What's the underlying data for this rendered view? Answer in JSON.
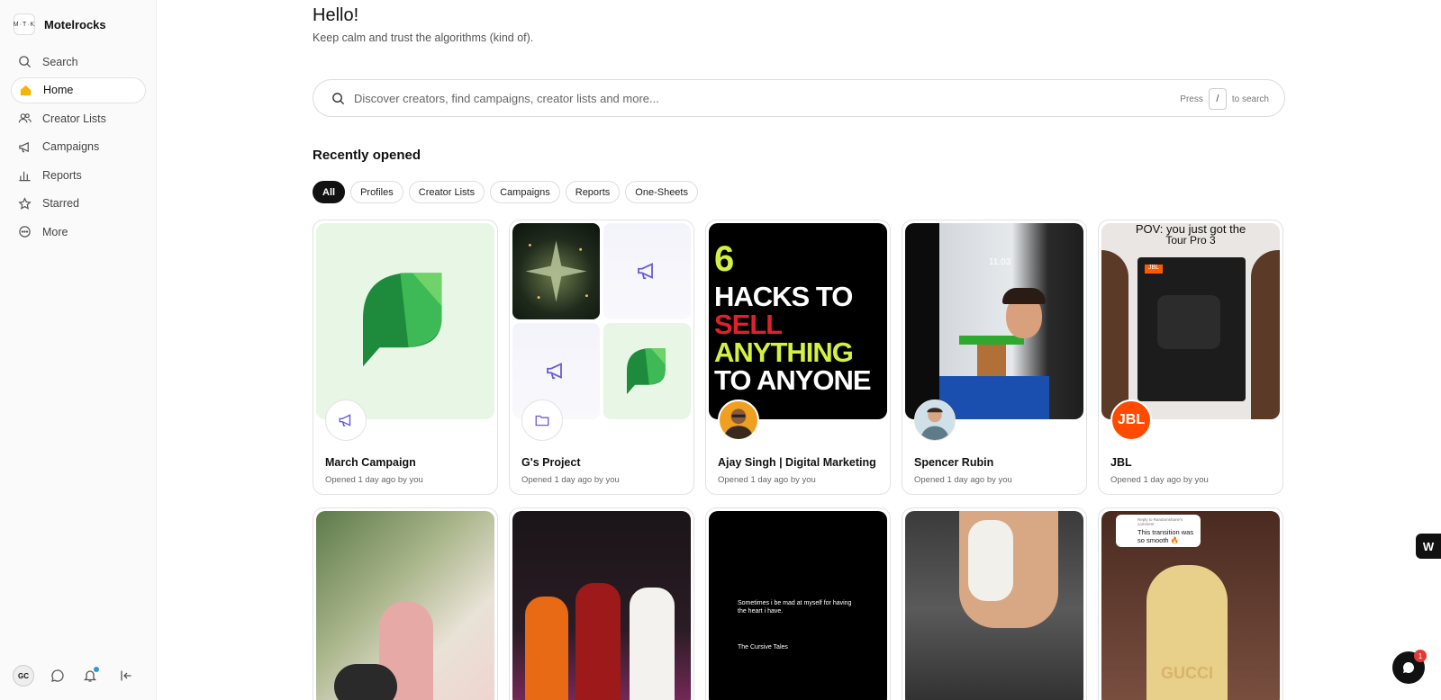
{
  "app": {
    "name": "Motelrocks",
    "logo_text": "M·T·K"
  },
  "sidebar": {
    "items": [
      {
        "label": "Search",
        "icon": "search-icon"
      },
      {
        "label": "Home",
        "icon": "home-icon",
        "active": true
      },
      {
        "label": "Creator Lists",
        "icon": "users-icon"
      },
      {
        "label": "Campaigns",
        "icon": "megaphone-icon"
      },
      {
        "label": "Reports",
        "icon": "bar-chart-icon"
      },
      {
        "label": "Starred",
        "icon": "star-icon"
      },
      {
        "label": "More",
        "icon": "more-icon"
      }
    ],
    "user_initials": "GC"
  },
  "header": {
    "greeting": "Hello!",
    "subtitle": "Keep calm and trust the algorithms (kind of)."
  },
  "search": {
    "placeholder": "Discover creators, find campaigns, creator lists and more...",
    "hint_prefix": "Press",
    "hint_key": "/",
    "hint_suffix": "to search"
  },
  "recent": {
    "title": "Recently opened",
    "filters": [
      "All",
      "Profiles",
      "Creator Lists",
      "Campaigns",
      "Reports",
      "One-Sheets"
    ],
    "cards": [
      {
        "title": "March Campaign",
        "meta": "Opened 1 day ago by you"
      },
      {
        "title": "G's Project",
        "meta": "Opened 1 day ago by you"
      },
      {
        "title": "Ajay Singh | Digital Marketing",
        "meta": "Opened 1 day ago by you"
      },
      {
        "title": "Spencer Rubin",
        "meta": "Opened 1 day ago by you"
      },
      {
        "title": "JBL",
        "meta": "Opened 1 day ago by you"
      }
    ],
    "thumb_texts": {
      "hacks": [
        "6",
        "HACKS TO",
        "SELL",
        "ANYTHING",
        "TO ANYONE"
      ],
      "game_time": "11.03",
      "jbl_top": "POV: you just got the",
      "jbl_sub": "Tour Pro 3",
      "jbl_logo": "JBL",
      "quote_1": "Sometimes i be mad at myself for having the heart i have.",
      "quote_2": "The Cursive Tales",
      "comment_header": "Reply to Randomshane's comment",
      "comment_text": "This transition was so smooth 🔥",
      "gucci": "GUCCI"
    }
  },
  "widgets": {
    "right_tab": "W",
    "chat_count": "1"
  },
  "colors": {
    "accent": "#f5b400",
    "chip_active": "#111111",
    "green_dark": "#1e8a3c",
    "green_light": "#6fd36a",
    "purple": "#6b5bd6"
  }
}
